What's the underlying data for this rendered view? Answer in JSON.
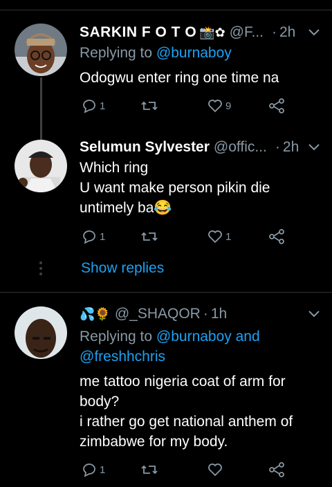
{
  "tweets": [
    {
      "name": "SARKIN F O T O",
      "name_emoji": "📸✿",
      "handle": "@F...",
      "time": "2h",
      "reply_prefix": "Replying to",
      "reply_to": "@burnaboy",
      "text_lines": [
        "Odogwu enter ring one time na"
      ],
      "replies": "1",
      "retweets": "",
      "likes": "9"
    },
    {
      "name": "Selumun Sylvester",
      "handle": "@offic...",
      "time": "2h",
      "text_lines": [
        "Which ring",
        "U want make person pikin die",
        "untimely ba😂"
      ],
      "replies": "1",
      "retweets": "",
      "likes": "1"
    },
    {
      "name_emoji": "💦🌻",
      "handle": "@_SHAQOR",
      "time": "1h",
      "reply_prefix": "Replying to",
      "reply_to_1": "@burnaboy and",
      "reply_to_2": "@freshhchris",
      "text_lines": [
        "me tattoo nigeria coat of arm for",
        "body?",
        "i rather go get national anthem of",
        "zimbabwe for my body."
      ],
      "replies": "1",
      "retweets": "",
      "likes": ""
    }
  ],
  "show_replies": "Show replies",
  "separator": "·",
  "colors": {
    "background": "#000000",
    "text": "#ffffff",
    "secondary": "#8899a6",
    "accent": "#1da1f2",
    "divider": "#2f3336"
  }
}
